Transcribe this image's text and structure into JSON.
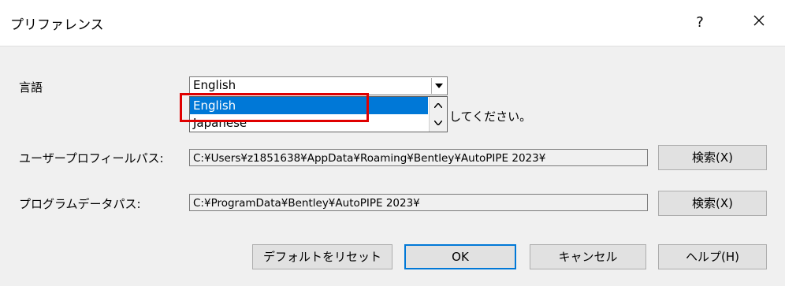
{
  "window": {
    "title": "プリファレンス",
    "help_glyph": "?",
    "close_glyph": "✕"
  },
  "language": {
    "label": "言語",
    "selected": "English",
    "options": [
      "English",
      "Japanese"
    ],
    "hint_tail": "してください。"
  },
  "profile": {
    "label": "ユーザープロフィールパス:",
    "value": "C:¥Users¥z1851638¥AppData¥Roaming¥Bentley¥AutoPIPE 2023¥",
    "browse": "検索(X)"
  },
  "programdata": {
    "label": "プログラムデータパス:",
    "value": "C:¥ProgramData¥Bentley¥AutoPIPE 2023¥",
    "browse": "検索(X)"
  },
  "buttons": {
    "reset": "デフォルトをリセット",
    "ok": "OK",
    "cancel": "キャンセル",
    "help": "ヘルプ(H)"
  },
  "colors": {
    "selection": "#0078d7",
    "highlight": "#e00000"
  }
}
